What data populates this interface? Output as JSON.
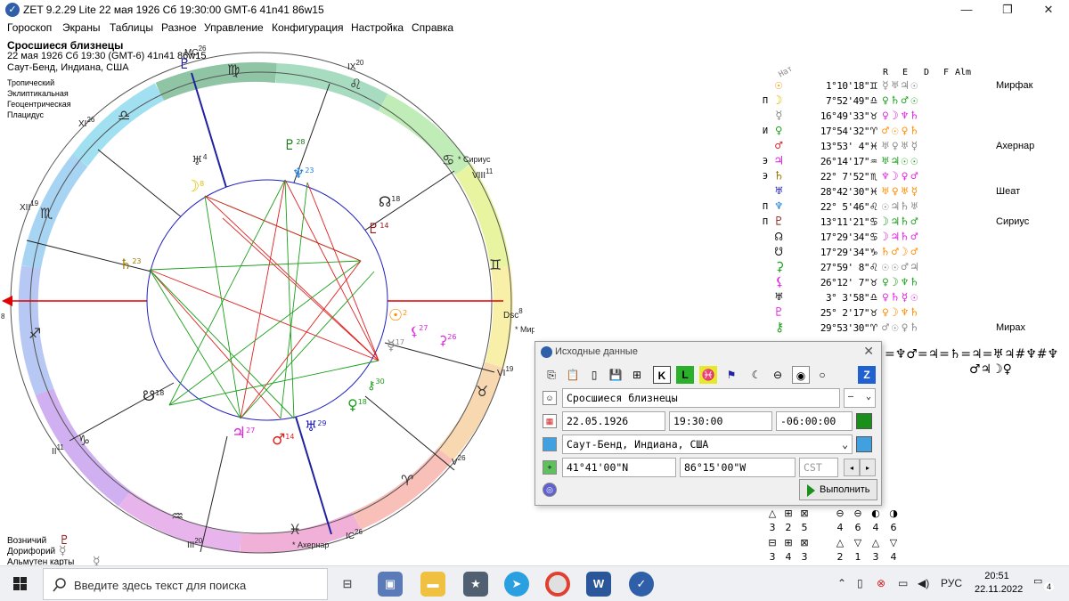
{
  "window": {
    "title": "ZET 9.2.29 Lite   22 мая 1926  Сб  19:30:00 GMT-6 41n41  86w15",
    "minimize": "—",
    "maximize": "❐",
    "close": "✕"
  },
  "menu": [
    "Гороскоп",
    "Экраны",
    "Таблицы",
    "Разное",
    "Управление",
    "Конфигурация",
    "Настройка",
    "Справка"
  ],
  "chart_header": {
    "name": "Сросшиеся близнецы",
    "line1": "22 мая 1926  Сб  19:30 (GMT-6) 41n41  86w15",
    "line2": "Саут-Бенд, Индиана, США",
    "settings": [
      "Тропический",
      "Эклиптикальная",
      "Геоцентрическая",
      "Плацидус"
    ]
  },
  "house_labels": {
    "mc": "MC",
    "mc_deg": "26",
    "ix": "IX",
    "ix_deg": "20",
    "viii": "VIII",
    "viii_deg": "11",
    "vi": "VI",
    "vi_deg": "19",
    "v": "V",
    "v_deg": "26",
    "ic": "IC",
    "ic_deg": "26",
    "iii": "III",
    "iii_deg": "20",
    "ii": "II",
    "ii_deg": "11",
    "xii": "XII",
    "xii_deg": "19",
    "xi": "XI",
    "xi_deg": "26",
    "asc_deg": "8",
    "dsc": "Dsc",
    "dsc_deg": "8"
  },
  "chart_stars": {
    "sirius": "Сириус",
    "mirfak": "Мирфак",
    "achernar": "Ахернар"
  },
  "chart_planets": {
    "jupiter_deg": "27",
    "mars_deg": "14",
    "uranus_deg": "29",
    "venus_deg": "18",
    "pluto_deg": "14",
    "node_deg": "18",
    "south_node_deg": "18",
    "saturn_deg": "23",
    "moon_deg": "8",
    "neptune_deg": "23",
    "proserpina_deg": "28",
    "sun_deg": "2",
    "mercury_deg": "17",
    "lilith_deg": "27",
    "selena_deg": "26",
    "chiron_deg": "30",
    "hades_deg": "4"
  },
  "bottom_info": {
    "ruler_label": "Возничий",
    "doryphory_label": "Дорифорий",
    "almuten_label": "Альмутен карты"
  },
  "planet_table": {
    "headers": {
      "nat": "Нат",
      "r": "R",
      "e": "E",
      "d": "D",
      "f": "F",
      "alm": "Alm"
    },
    "rows": [
      {
        "mark": "",
        "glyph": "☉",
        "color": "#ff8c00",
        "deg": "1°10'18\"",
        "sign": "♊",
        "digs": "☿♅♃☉",
        "star": "Мирфак"
      },
      {
        "mark": "П",
        "glyph": "☽",
        "color": "#e0c000",
        "deg": "7°52'49\"",
        "sign": "♎",
        "digs": "♀♄♂☉",
        "star": ""
      },
      {
        "mark": "",
        "glyph": "☿",
        "color": "#888888",
        "deg": "16°49'33\"",
        "sign": "♉",
        "digs": "♀☽♆♄",
        "star": ""
      },
      {
        "mark": "И",
        "glyph": "♀",
        "color": "#1a9f1a",
        "deg": "17°54'32\"",
        "sign": "♈",
        "digs": "♂☉♀♄",
        "star": ""
      },
      {
        "mark": "",
        "glyph": "♂",
        "color": "#e02020",
        "deg": "13°53' 4\"",
        "sign": "♓",
        "digs": "♅♀♅☿",
        "star": "Ахернар"
      },
      {
        "mark": "Э",
        "glyph": "♃",
        "color": "#e020e0",
        "deg": "26°14'17\"",
        "sign": "♒",
        "digs": "♅♃☉☉",
        "star": ""
      },
      {
        "mark": "Э",
        "glyph": "♄",
        "color": "#9a7a00",
        "deg": "22° 7'52\"",
        "sign": "♏",
        "digs": "♆☽♀♂",
        "star": ""
      },
      {
        "mark": "",
        "glyph": "♅",
        "color": "#2020c0",
        "deg": "28°42'30\"",
        "sign": "♓",
        "digs": "♅♀♅☿",
        "star": "Шеат"
      },
      {
        "mark": "П",
        "glyph": "♆",
        "color": "#2080e0",
        "deg": "22° 5'46\"",
        "sign": "♌",
        "digs": "☉♃♄♅",
        "star": ""
      },
      {
        "mark": "П",
        "glyph": "♇",
        "color": "#8b1a1a",
        "deg": "13°11'21\"",
        "sign": "♋",
        "digs": "☽♃♄♂",
        "star": "Сириус"
      },
      {
        "mark": "",
        "glyph": "☊",
        "color": "#000000",
        "deg": "17°29'34\"",
        "sign": "♋",
        "digs": "☽♃♄♂",
        "star": ""
      },
      {
        "mark": "",
        "glyph": "☋",
        "color": "#000000",
        "deg": "17°29'34\"",
        "sign": "♑",
        "digs": "♄♂☽♂",
        "star": ""
      },
      {
        "mark": "",
        "glyph": "⚳",
        "color": "#1a9f1a",
        "deg": "27°59' 8\"",
        "sign": "♌",
        "digs": "☉☉♂♃",
        "star": ""
      },
      {
        "mark": "",
        "glyph": "⚸",
        "color": "#e020e0",
        "deg": "26°12' 7\"",
        "sign": "♉",
        "digs": "♀☽♆♄",
        "star": ""
      },
      {
        "mark": "",
        "glyph": "♅",
        "color": "#000000",
        "deg": "3° 3'58\"",
        "sign": "♎",
        "digs": "♀♄☿☉",
        "star": ""
      },
      {
        "mark": "",
        "glyph": "♇",
        "color": "#e020e0",
        "deg": "25° 2'17\"",
        "sign": "♉",
        "digs": "♀☽♆♄",
        "star": ""
      },
      {
        "mark": "",
        "glyph": "⚷",
        "color": "#1a9f1a",
        "deg": "29°53'30\"",
        "sign": "♈",
        "digs": "♂☉♀♄",
        "star": "Мирах"
      }
    ]
  },
  "aspect_string": {
    "line1": "=♆♂=♃=♄=♃=♅♃#♆#♆",
    "line2": "♂♃☽♀"
  },
  "dialog": {
    "title": "Исходные данные",
    "close": "✕",
    "name_value": "Сросшиеся близнецы",
    "gender_value": "—",
    "date_value": "22.05.1926",
    "time_value": "19:30:00",
    "gmt_value": "-06:00:00",
    "place_value": "Саут-Бенд, Индиана, США",
    "lat_value": "41°41'00\"N",
    "lon_value": "86°15'00\"W",
    "zone_value": "CST",
    "run_button": "Выполнить",
    "toolbar": [
      "⎘",
      "📋",
      "▯",
      "💾",
      "⊞",
      "K",
      "L",
      "♓",
      "⚑",
      "☾",
      "⊖",
      "◉",
      "○",
      "Z"
    ]
  },
  "aspect_legend": {
    "row1_symbols": [
      "△",
      "⊞",
      "⊠",
      "⊖",
      "⊖",
      "◐",
      "◑"
    ],
    "row1_values": [
      "3",
      "2",
      "5",
      "4",
      "6",
      "4",
      "6"
    ],
    "row2_symbols": [
      "⊟",
      "⊞",
      "⊠",
      "△",
      "▽",
      "△",
      "▽"
    ],
    "row2_values": [
      "3",
      "4",
      "3",
      "2",
      "1",
      "3",
      "4"
    ]
  },
  "taskbar": {
    "search_placeholder": "Введите здесь текст для поиска",
    "language": "РУС",
    "time": "20:51",
    "date": "22.11.2022",
    "notifications": "4"
  },
  "colors": {
    "asc_dsc": "#e00000",
    "mc_ic": "#2020a0",
    "aspect_red": "#e02020",
    "aspect_green": "#1a9f1a",
    "inner_circle": "#2020c0"
  }
}
